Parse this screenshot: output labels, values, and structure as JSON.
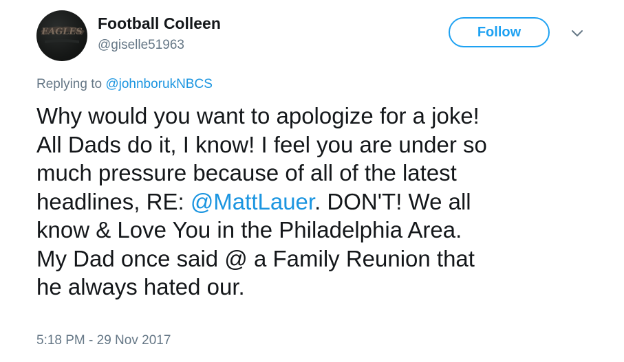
{
  "author": {
    "name": "Football Colleen",
    "handle": "@giselle51963",
    "avatar_text": "EAGLES"
  },
  "actions": {
    "follow_label": "Follow",
    "menu_icon": "chevron-down-icon"
  },
  "reply": {
    "prefix": "Replying to ",
    "mention": "@johnborukNBCS"
  },
  "tweet": {
    "line1": "Why would you want to apologize for a joke!",
    "line2": "All Dads do it, I know! I feel you are under so",
    "line3": "much pressure because of all of the latest",
    "line4_before": "headlines, RE: ",
    "line4_mention": "@MattLauer",
    "line4_after": ". DON'T! We all",
    "line5": "know & Love You in the Philadelphia Area.",
    "line6": "My Dad once said @ a Family Reunion that",
    "line7": "he always hated our."
  },
  "timestamp": "5:18 PM - 29 Nov 2017",
  "colors": {
    "accent": "#1da1f2",
    "mention": "#1b95e0",
    "muted": "#657786",
    "text": "#14171a"
  }
}
